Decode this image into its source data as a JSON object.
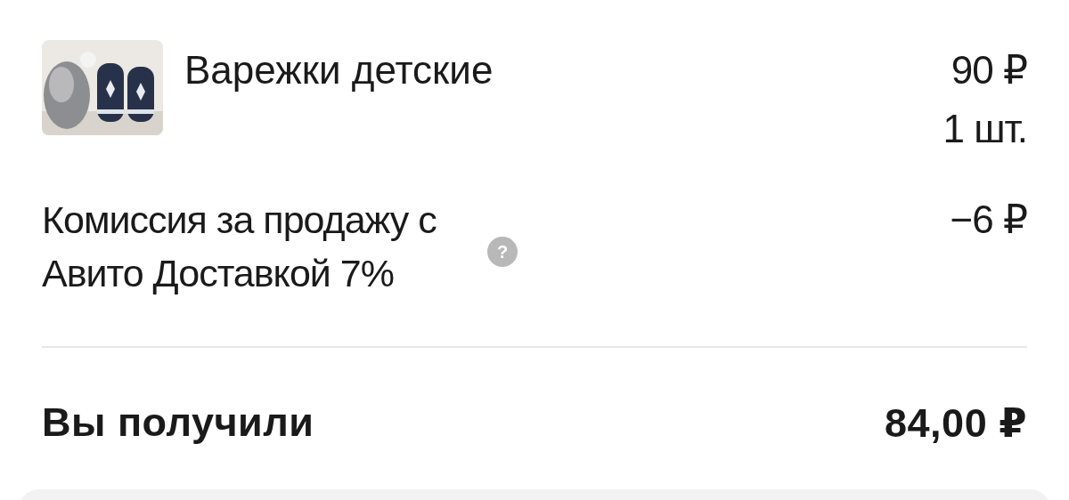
{
  "item": {
    "title": "Варежки детские",
    "price": "90 ₽",
    "quantity": "1 шт."
  },
  "commission": {
    "label": "Комиссия за продажу с Авито Доставкой 7%",
    "help": "?",
    "amount": "−6 ₽"
  },
  "total": {
    "label": "Вы получили",
    "amount": "84,00 ₽"
  }
}
